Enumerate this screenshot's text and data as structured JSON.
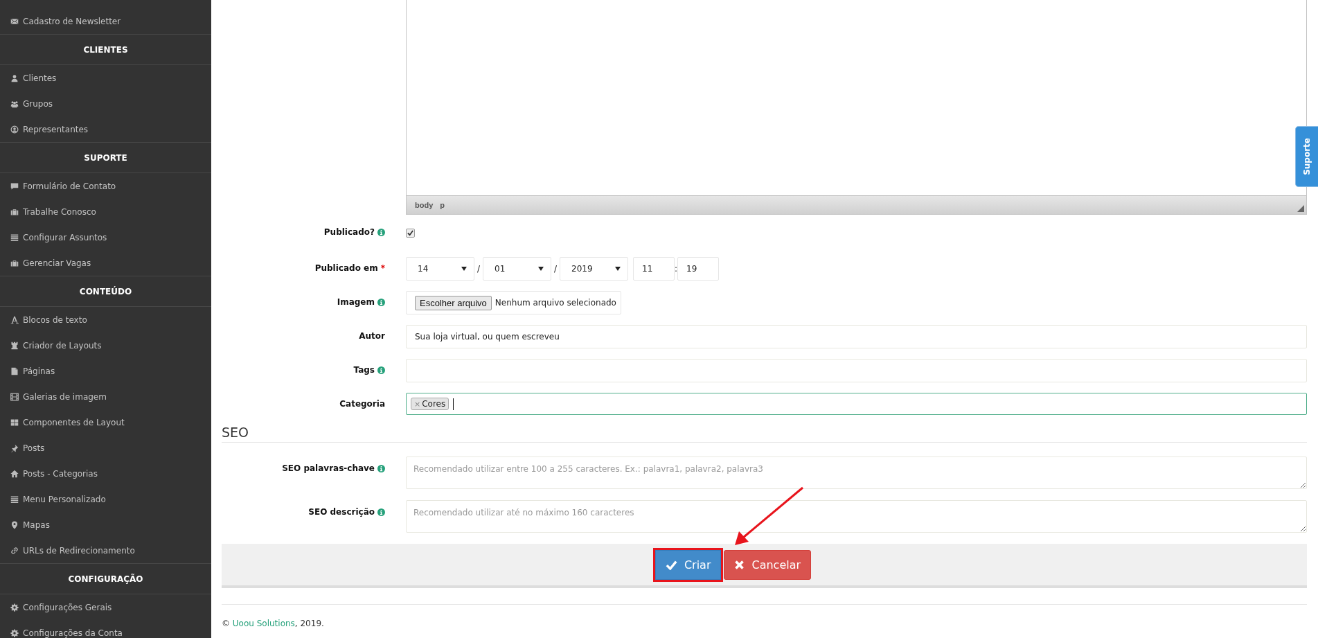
{
  "sidebar": {
    "sections": [
      {
        "items": [
          {
            "label": "Cadastro de Newsletter",
            "kind": "envelope"
          }
        ]
      },
      {
        "title": "CLIENTES",
        "items": [
          {
            "label": "Clientes",
            "kind": "user"
          },
          {
            "label": "Grupos",
            "kind": "users"
          },
          {
            "label": "Representantes",
            "kind": "usercircle"
          }
        ]
      },
      {
        "title": "SUPORTE",
        "items": [
          {
            "label": "Formulário de Contato",
            "kind": "comment"
          },
          {
            "label": "Trabalhe Conosco",
            "kind": "briefcase"
          },
          {
            "label": "Configurar Assuntos",
            "kind": "list"
          },
          {
            "label": "Gerenciar Vagas",
            "kind": "briefcase"
          }
        ]
      },
      {
        "title": "CONTEÚDO",
        "items": [
          {
            "label": "Blocos de texto",
            "kind": "font"
          },
          {
            "label": "Criador de Layouts",
            "kind": "rook"
          },
          {
            "label": "Páginas",
            "kind": "file"
          },
          {
            "label": "Galerias de imagem",
            "kind": "film"
          },
          {
            "label": "Componentes de Layout",
            "kind": "grid"
          },
          {
            "label": "Posts",
            "kind": "pin"
          },
          {
            "label": "Posts - Categorias",
            "kind": "home"
          },
          {
            "label": "Menu Personalizado",
            "kind": "list"
          },
          {
            "label": "Mapas",
            "kind": "marker"
          },
          {
            "label": "URLs de Redirecionamento",
            "kind": "link"
          }
        ]
      },
      {
        "title": "CONFIGURAÇÃO",
        "items": [
          {
            "label": "Configurações Gerais",
            "kind": "gear"
          },
          {
            "label": "Configurações da Conta",
            "kind": "gear"
          }
        ]
      }
    ]
  },
  "editor": {
    "path": [
      "body",
      "p"
    ]
  },
  "support_tab": {
    "label": "Suporte"
  },
  "fields": [
    {
      "kind": "checkbox",
      "label": "Publicado?",
      "info": true,
      "required": false,
      "checked": true
    },
    {
      "kind": "datetime",
      "label": "Publicado em",
      "info": false,
      "required": true,
      "required_mark": "*",
      "day": "14",
      "month": "01",
      "year": "2019",
      "hour": "11",
      "minute": "19",
      "separators": [
        "/",
        "/",
        ":"
      ]
    },
    {
      "kind": "file",
      "label": "Imagem",
      "info": true,
      "required": false,
      "button": "Escolher arquivo",
      "status": "Nenhum arquivo selecionado"
    },
    {
      "kind": "text",
      "label": "Autor",
      "info": false,
      "required": false,
      "value": "Sua loja virtual, ou quem escreveu"
    },
    {
      "kind": "text",
      "label": "Tags",
      "info": true,
      "required": false
    },
    {
      "kind": "tags",
      "label": "Categoria",
      "info": false,
      "required": false,
      "focused": true,
      "tags": [
        {
          "label": "Cores",
          "remove": "×"
        }
      ]
    }
  ],
  "seo": {
    "title": "SEO",
    "fields": [
      {
        "label": "SEO palavras-chave",
        "info": true,
        "placeholder": "Recomendado utilizar entre 100 a 255 caracteres. Ex.: palavra1, palavra2, palavra3"
      },
      {
        "label": "SEO descrição",
        "info": true,
        "placeholder": "Recomendado utilizar até no máximo 160 caracteres"
      }
    ]
  },
  "actions": [
    {
      "label": "Criar",
      "kind": "primary",
      "highlighted": true
    },
    {
      "label": "Cancelar",
      "kind": "danger",
      "highlighted": false
    }
  ],
  "footer": {
    "prefix": "© ",
    "link": "Uoou Solutions",
    "suffix": ", 2019."
  }
}
